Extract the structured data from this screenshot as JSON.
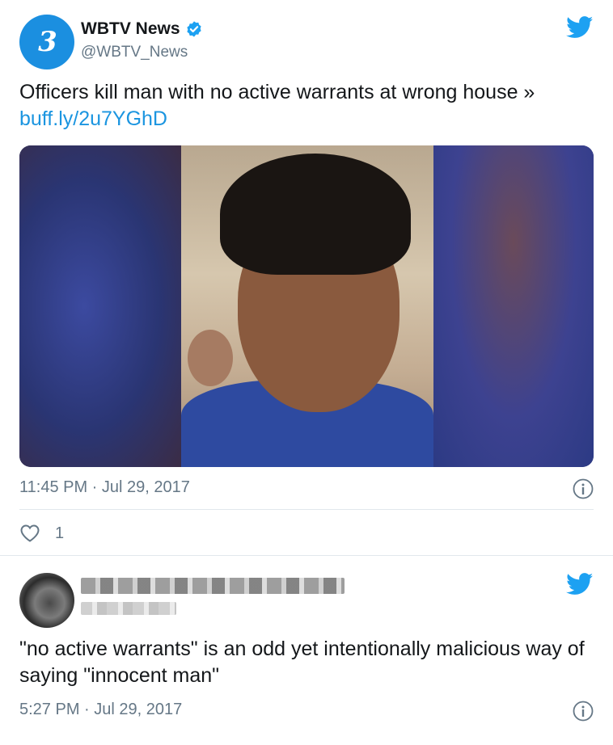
{
  "tweet1": {
    "display_name": "WBTV News",
    "handle": "@WBTV_News",
    "avatar_text": "3",
    "text_main": "Officers kill man with no active warrants at wrong house » ",
    "link_text": "buff.ly/2u7YGhD",
    "timestamp": "11:45 PM · Jul 29, 2017",
    "like_count": "1"
  },
  "tweet2": {
    "text": "\"no active warrants\" is an odd yet intentionally malicious way of saying \"innocent man\"",
    "timestamp": "5:27 PM · Jul 29, 2017"
  },
  "colors": {
    "link": "#1b95e0",
    "verified": "#1da1f2",
    "twitter_bird": "#1da1f2",
    "muted": "#657786"
  },
  "icons": {
    "brand": "twitter-bird-icon",
    "verified": "verified-badge-icon",
    "info": "info-icon",
    "like": "heart-icon"
  }
}
